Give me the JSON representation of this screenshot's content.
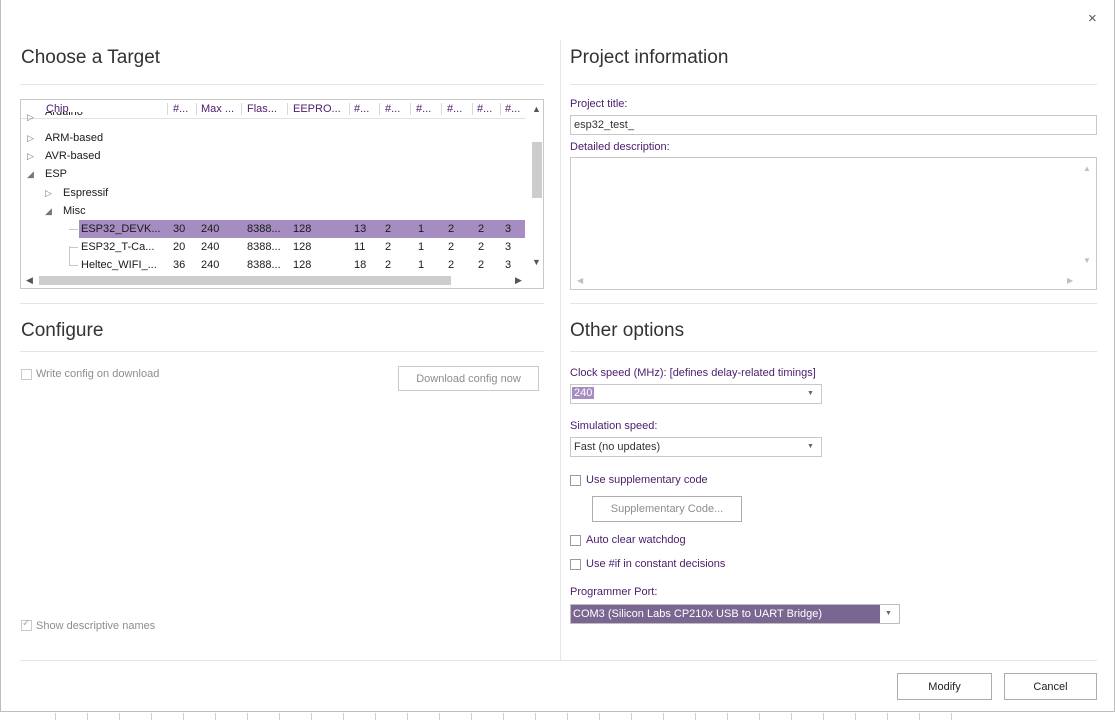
{
  "window": {
    "close_glyph": "×"
  },
  "target": {
    "heading": "Choose a Target",
    "columns": [
      "Chip",
      "#...",
      "Max ...",
      "Flas...",
      "EEPRO...",
      "#...",
      "#...",
      "#...",
      "#...",
      "#...",
      "#..."
    ],
    "cut_row": "Arduino",
    "tree": [
      {
        "label": "ARM-based",
        "level": 0,
        "expander": "▷"
      },
      {
        "label": "AVR-based",
        "level": 0,
        "expander": "▷"
      },
      {
        "label": "ESP",
        "level": 0,
        "expander": "◢"
      },
      {
        "label": "Espressif",
        "level": 1,
        "expander": "▷"
      },
      {
        "label": "Misc",
        "level": 1,
        "expander": "◢"
      }
    ],
    "chips": [
      {
        "name": "ESP32_DEVK...",
        "values": [
          "30",
          "240",
          "8388...",
          "128",
          "13",
          "2",
          "1",
          "2",
          "2",
          "3"
        ],
        "selected": true
      },
      {
        "name": "ESP32_T-Ca...",
        "values": [
          "20",
          "240",
          "8388...",
          "128",
          "11",
          "2",
          "1",
          "2",
          "2",
          "3"
        ],
        "selected": false
      },
      {
        "name": "Heltec_WIFI_...",
        "values": [
          "36",
          "240",
          "8388...",
          "128",
          "18",
          "2",
          "1",
          "2",
          "2",
          "3"
        ],
        "selected": false
      }
    ]
  },
  "configure": {
    "heading": "Configure",
    "write_config_label": "Write config on download",
    "download_button": "Download config now",
    "show_descriptive_label": "Show descriptive names",
    "show_descriptive_checked": true
  },
  "project": {
    "heading": "Project information",
    "title_label": "Project title:",
    "title_value": "esp32_test_",
    "description_label": "Detailed description:",
    "description_value": ""
  },
  "options": {
    "heading": "Other options",
    "clock_label": "Clock speed (MHz): [defines delay-related timings]",
    "clock_value": "240",
    "sim_label": "Simulation speed:",
    "sim_value": "Fast (no updates)",
    "supp_code_label": "Use supplementary code",
    "supp_code_button": "Supplementary Code...",
    "watchdog_label": "Auto clear watchdog",
    "ifdef_label": "Use #if in constant decisions",
    "port_label": "Programmer Port:",
    "port_value": "COM3 (Silicon Labs CP210x USB to UART Bridge)"
  },
  "footer": {
    "modify_button": "Modify",
    "cancel_button": "Cancel"
  },
  "colors": {
    "accent": "#a58dc2",
    "port_bg": "#7a6690",
    "label": "#4a1c6b"
  }
}
